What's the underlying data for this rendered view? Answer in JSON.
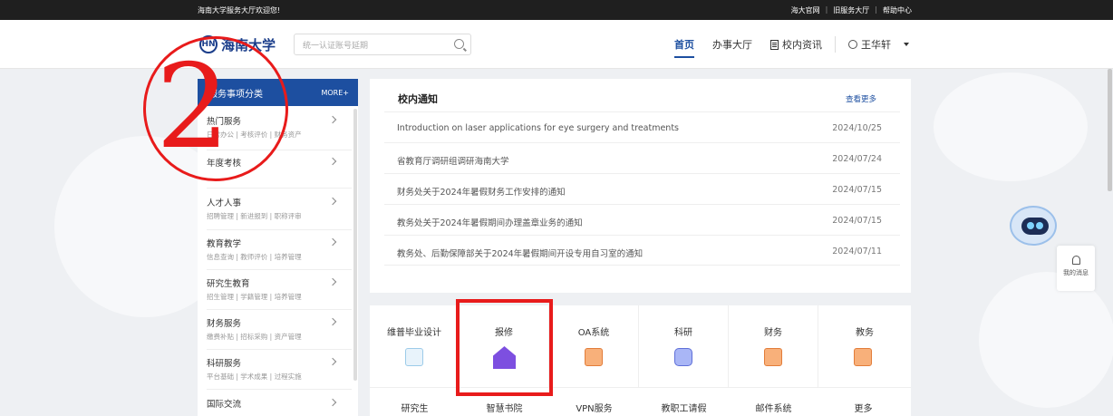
{
  "topbar": {
    "welcome": "海南大学服务大厅欢迎您!",
    "links": [
      "海大官网",
      "旧服务大厅",
      "帮助中心"
    ],
    "separator": "|"
  },
  "header": {
    "logo_text": "海南大学",
    "logo_seal": "HN",
    "search_placeholder": "统一认证账号延期",
    "nav": {
      "home": "首页",
      "service_hall": "办事大厅",
      "campus_news": "校内资讯",
      "user": "王华轩"
    }
  },
  "sidebar": {
    "title": "服务事项分类",
    "more": "MORE+",
    "categories": [
      {
        "title": "热门服务",
        "sub": "日常办公 | 考核评价 | 财务资产"
      },
      {
        "title": "年度考核",
        "sub": ""
      },
      {
        "title": "人才人事",
        "sub": "招聘管理 | 新进报到 | 职称评审"
      },
      {
        "title": "教育教学",
        "sub": "信息查询 | 教师评价 | 培养管理"
      },
      {
        "title": "研究生教育",
        "sub": "招生管理 | 学籍管理 | 培养管理"
      },
      {
        "title": "财务服务",
        "sub": "缴费补贴 | 招标采购 | 资产管理"
      },
      {
        "title": "科研服务",
        "sub": "平台基础 | 学术成果 | 过程实施"
      },
      {
        "title": "国际交流",
        "sub": ""
      }
    ]
  },
  "notice": {
    "title": "校内通知",
    "more": "查看更多",
    "items": [
      {
        "title": "Introduction on laser applications for eye surgery and treatments",
        "date": "2024/10/25"
      },
      {
        "title": "省教育厅调研组调研海南大学",
        "date": "2024/07/24"
      },
      {
        "title": "财务处关于2024年暑假财务工作安排的通知",
        "date": "2024/07/15"
      },
      {
        "title": "教务处关于2024年暑假期间办理盖章业务的通知",
        "date": "2024/07/15"
      },
      {
        "title": "教务处、后勤保障部关于2024年暑假期间开设专用自习室的通知",
        "date": "2024/07/11"
      }
    ]
  },
  "apps": {
    "row1": [
      {
        "label": "维普毕业设计",
        "icon": "document-icon"
      },
      {
        "label": "报修",
        "icon": "repair-house-icon"
      },
      {
        "label": "OA系统",
        "icon": "oa-icon"
      },
      {
        "label": "科研",
        "icon": "research-icon"
      },
      {
        "label": "财务",
        "icon": "finance-icon"
      },
      {
        "label": "教务",
        "icon": "teaching-icon"
      }
    ],
    "row2": [
      "研究生",
      "智慧书院",
      "VPN服务",
      "教职工请假",
      "邮件系统",
      "更多"
    ]
  },
  "annotation": {
    "number": "2"
  },
  "floating": {
    "messages": "我的消息"
  },
  "colors": {
    "brand": "#1d4fa0",
    "highlight": "#e81b1b",
    "topbar": "#1f1f1f"
  }
}
